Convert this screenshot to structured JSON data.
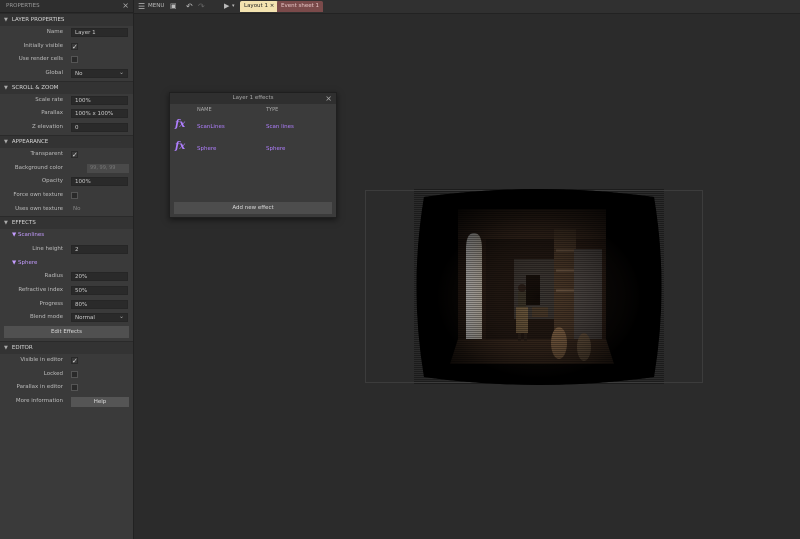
{
  "properties": {
    "title": "PROPERTIES",
    "layer_section": "LAYER PROPERTIES",
    "name_label": "Name",
    "name_value": "Layer 1",
    "initially_visible_label": "Initially visible",
    "use_render_cells_label": "Use render cells",
    "global_label": "Global",
    "global_value": "No",
    "scroll_section": "SCROLL & ZOOM",
    "scale_rate_label": "Scale rate",
    "scale_rate_value": "100%",
    "parallax_label": "Parallax",
    "parallax_value": "100% x 100%",
    "z_elevation_label": "Z elevation",
    "z_elevation_value": "0",
    "appearance_section": "APPEARANCE",
    "transparent_label": "Transparent",
    "background_color_label": "Background color",
    "background_color_value": "99, 99, 99",
    "opacity_label": "Opacity",
    "opacity_value": "100%",
    "force_own_texture_label": "Force own texture",
    "uses_own_texture_label": "Uses own texture",
    "uses_own_texture_value": "No",
    "effects_section": "EFFECTS",
    "scanlines_group": "Scanlines",
    "line_height_label": "Line height",
    "line_height_value": "2",
    "sphere_group": "Sphere",
    "radius_label": "Radius",
    "radius_value": "20%",
    "refractive_label": "Refractive index",
    "refractive_value": "50%",
    "progress_label": "Progress",
    "progress_value": "80%",
    "blend_mode_label": "Blend mode",
    "blend_mode_value": "Normal",
    "edit_effects": "Edit Effects",
    "editor_section": "EDITOR",
    "visible_in_editor_label": "Visible in editor",
    "locked_label": "Locked",
    "parallax_in_editor_label": "Parallax in editor",
    "more_info_label": "More information",
    "help_label": "Help"
  },
  "toolbar": {
    "menu_label": "MENU",
    "tab_layout": "Layout 1",
    "tab_event": "Event sheet 1"
  },
  "dialog": {
    "title": "Layer 1 effects",
    "col_name": "NAME",
    "col_type": "TYPE",
    "effects": [
      {
        "name": "ScanLines",
        "type": "Scan lines"
      },
      {
        "name": "Sphere",
        "type": "Sphere"
      }
    ],
    "add_label": "Add new effect"
  },
  "colors": {
    "accent_purple": "#b07fff",
    "tab_layout_bg": "#f3e3b0",
    "tab_event_bg": "#7a4a4a"
  }
}
